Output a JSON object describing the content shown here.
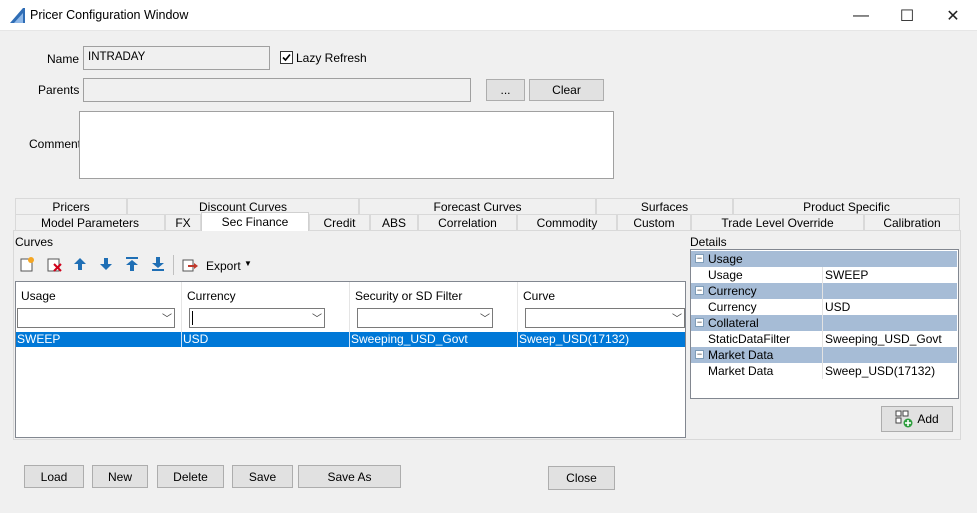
{
  "window": {
    "title": "Pricer Configuration Window",
    "minimize": "—",
    "maximize": "☐",
    "close": "✕"
  },
  "form": {
    "name_label": "Name",
    "name_value": "INTRADAY",
    "lazy_refresh_label": "Lazy Refresh",
    "lazy_refresh_checked": true,
    "parents_label": "Parents",
    "parents_value": "",
    "ellipsis_label": "...",
    "clear_label": "Clear",
    "comment_label": "Comment",
    "comment_value": ""
  },
  "tabs_row1": [
    "Pricers",
    "Discount Curves",
    "Forecast Curves",
    "Surfaces",
    "Product Specific"
  ],
  "tabs_row2": [
    "Model Parameters",
    "FX",
    "Sec Finance",
    "Credit",
    "ABS",
    "Correlation",
    "Commodity",
    "Custom",
    "Trade Level Override",
    "Calibration"
  ],
  "active_tab": "Sec Finance",
  "curves": {
    "label": "Curves",
    "export_label": "Export",
    "columns": [
      "Usage",
      "Currency",
      "Security or SD Filter",
      "Curve"
    ],
    "rows": [
      [
        "SWEEP",
        "USD",
        "Sweeping_USD_Govt",
        "Sweep_USD(17132)"
      ]
    ]
  },
  "details": {
    "label": "Details",
    "groups": [
      {
        "name": "Usage",
        "key": "Usage",
        "value": "SWEEP"
      },
      {
        "name": "Currency",
        "key": "Currency",
        "value": "USD"
      },
      {
        "name": "Collateral",
        "key": "StaticDataFilter",
        "value": "Sweeping_USD_Govt"
      },
      {
        "name": "Market Data",
        "key": "Market Data",
        "value": "Sweep_USD(17132)"
      }
    ],
    "add_label": "Add"
  },
  "footer": {
    "load": "Load",
    "new": "New",
    "delete": "Delete",
    "save": "Save",
    "save_as": "Save As",
    "close": "Close"
  },
  "colors": {
    "selection": "#0078d7",
    "group_header": "#a6bcd6"
  }
}
